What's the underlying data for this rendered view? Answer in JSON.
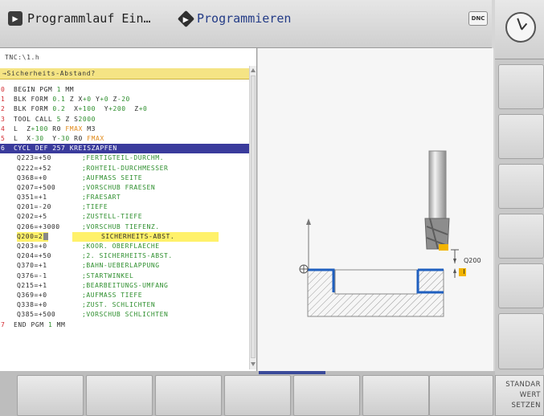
{
  "header": {
    "mode_run_label": "Programmlauf Ein…",
    "mode_prog_label": "Programmieren",
    "dnc_label": "DNC"
  },
  "editor": {
    "file_title": "TNC:\\1.h",
    "dialog_question": "→Sicherheits-Abstand?",
    "lines": [
      {
        "num": "0",
        "text": "BEGIN PGM 1 MM"
      },
      {
        "num": "1",
        "text": "BLK FORM 0.1 Z X+0 Y+0 Z-20"
      },
      {
        "num": "2",
        "text": "BLK FORM 0.2  X+100  Y+200  Z+0"
      },
      {
        "num": "3",
        "text": "TOOL CALL 5 Z S2000"
      },
      {
        "num": "4",
        "text": "L  Z+100 R0 FMAX M3"
      },
      {
        "num": "5",
        "text": "L  X-30  Y-30 R0 FMAX"
      },
      {
        "num": "6",
        "text": "CYCL DEF 257 KREISZAPFEN"
      }
    ],
    "params": [
      {
        "param": "Q223=+50",
        "comment": ";FERTIGTEIL-DURCHM."
      },
      {
        "param": "Q222=+52",
        "comment": ";ROHTEIL-DURCHMESSER"
      },
      {
        "param": "Q368=+0",
        "comment": ";AUFMASS SEITE"
      },
      {
        "param": "Q207=+500",
        "comment": ";VORSCHUB FRAESEN"
      },
      {
        "param": "Q351=+1",
        "comment": ";FRAESART"
      },
      {
        "param": "Q201=-20",
        "comment": ";TIEFE"
      },
      {
        "param": "Q202=+5",
        "comment": ";ZUSTELL-TIEFE"
      },
      {
        "param": "Q206=+3000",
        "comment": ";VORSCHUB TIEFENZ."
      },
      {
        "param": "Q200=2",
        "comment": "SICHERHEITS-ABST."
      },
      {
        "param": "Q203=+0",
        "comment": ";KOOR. OBERFLAECHE"
      },
      {
        "param": "Q204=+50",
        "comment": ";2. SICHERHEITS-ABST."
      },
      {
        "param": "Q370=+1",
        "comment": ";BAHN-UEBERLAPPUNG"
      },
      {
        "param": "Q376=-1",
        "comment": ";STARTWINKEL"
      },
      {
        "param": "Q215=+1",
        "comment": ";BEARBEITUNGS-UMFANG"
      },
      {
        "param": "Q369=+0",
        "comment": ";AUFMASS TIEFE"
      },
      {
        "param": "Q338=+0",
        "comment": ";ZUST. SCHLICHTEN"
      },
      {
        "param": "Q385=+500",
        "comment": ";VORSCHUB SCHLICHTEN"
      }
    ],
    "end_line": {
      "num": "7",
      "text": "END PGM 1 MM"
    }
  },
  "graphic": {
    "param_label": "Q200",
    "marker_label": "I"
  },
  "softkeys": {
    "right_bottom_line1": "STANDAR",
    "right_bottom_line2": "WERT",
    "right_bottom_line3": "SETZEN"
  },
  "colors": {
    "line_numbers": "#d2282e",
    "numbers": "#2e8f2e",
    "fmax": "#e08a1a",
    "highlight_line": "#3a3b9c",
    "highlight_param": "#fff16a",
    "dialog_bar": "#f5e484"
  }
}
